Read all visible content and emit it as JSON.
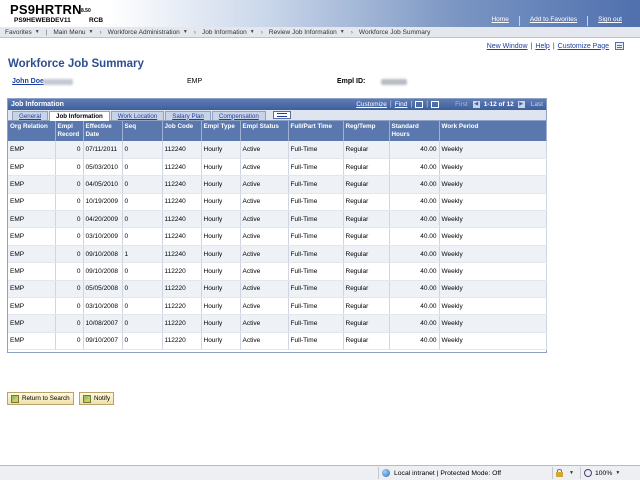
{
  "brand": {
    "title": "PS9HRTRN",
    "version": "8.50",
    "server": "PS9HEWEBDEV11",
    "user_code": "RCB"
  },
  "toplinks": [
    "Home",
    "Add to Favorites",
    "Sign out"
  ],
  "menubar": {
    "items": [
      "Favorites",
      "Main Menu",
      "Workforce Administration",
      "Job Information",
      "Review Job Information",
      "Workforce Job Summary"
    ]
  },
  "pagelinks": {
    "new_window": "New Window",
    "help": "Help",
    "customize_page": "Customize Page"
  },
  "page_title": "Workforce Job Summary",
  "employee": {
    "name": "John Doe",
    "org_relation": "EMP",
    "empl_id_label": "Empl ID:"
  },
  "grid": {
    "title": "Job Information",
    "customize": "Customize",
    "find": "Find",
    "first": "First",
    "range": "1-12 of 12",
    "last": "Last",
    "tabs": [
      "General",
      "Job Information",
      "Work Location",
      "Salary Plan",
      "Compensation"
    ],
    "active_tab": "Job Information",
    "columns": [
      "Org Relation",
      "Empl Record",
      "Effective Date",
      "Seq",
      "Job Code",
      "Empl Type",
      "Empl Status",
      "Full/Part Time",
      "Reg/Temp",
      "Standard Hours",
      "Work Period"
    ],
    "rows": [
      [
        "EMP",
        "0",
        "07/11/2011",
        "0",
        "112240",
        "Hourly",
        "Active",
        "Full-Time",
        "Regular",
        "40.00",
        "Weekly"
      ],
      [
        "EMP",
        "0",
        "05/03/2010",
        "0",
        "112240",
        "Hourly",
        "Active",
        "Full-Time",
        "Regular",
        "40.00",
        "Weekly"
      ],
      [
        "EMP",
        "0",
        "04/05/2010",
        "0",
        "112240",
        "Hourly",
        "Active",
        "Full-Time",
        "Regular",
        "40.00",
        "Weekly"
      ],
      [
        "EMP",
        "0",
        "10/19/2009",
        "0",
        "112240",
        "Hourly",
        "Active",
        "Full-Time",
        "Regular",
        "40.00",
        "Weekly"
      ],
      [
        "EMP",
        "0",
        "04/20/2009",
        "0",
        "112240",
        "Hourly",
        "Active",
        "Full-Time",
        "Regular",
        "40.00",
        "Weekly"
      ],
      [
        "EMP",
        "0",
        "03/10/2009",
        "0",
        "112240",
        "Hourly",
        "Active",
        "Full-Time",
        "Regular",
        "40.00",
        "Weekly"
      ],
      [
        "EMP",
        "0",
        "09/10/2008",
        "1",
        "112240",
        "Hourly",
        "Active",
        "Full-Time",
        "Regular",
        "40.00",
        "Weekly"
      ],
      [
        "EMP",
        "0",
        "09/10/2008",
        "0",
        "112220",
        "Hourly",
        "Active",
        "Full-Time",
        "Regular",
        "40.00",
        "Weekly"
      ],
      [
        "EMP",
        "0",
        "05/05/2008",
        "0",
        "112220",
        "Hourly",
        "Active",
        "Full-Time",
        "Regular",
        "40.00",
        "Weekly"
      ],
      [
        "EMP",
        "0",
        "03/10/2008",
        "0",
        "112220",
        "Hourly",
        "Active",
        "Full-Time",
        "Regular",
        "40.00",
        "Weekly"
      ],
      [
        "EMP",
        "0",
        "10/08/2007",
        "0",
        "112220",
        "Hourly",
        "Active",
        "Full-Time",
        "Regular",
        "40.00",
        "Weekly"
      ],
      [
        "EMP",
        "0",
        "09/10/2007",
        "0",
        "112220",
        "Hourly",
        "Active",
        "Full-Time",
        "Regular",
        "40.00",
        "Weekly"
      ]
    ]
  },
  "buttons": {
    "return_to_search": "Return to Search",
    "notify": "Notify"
  },
  "statusbar": {
    "zone": "Local intranet | Protected Mode: Off",
    "zoom": "100%"
  }
}
